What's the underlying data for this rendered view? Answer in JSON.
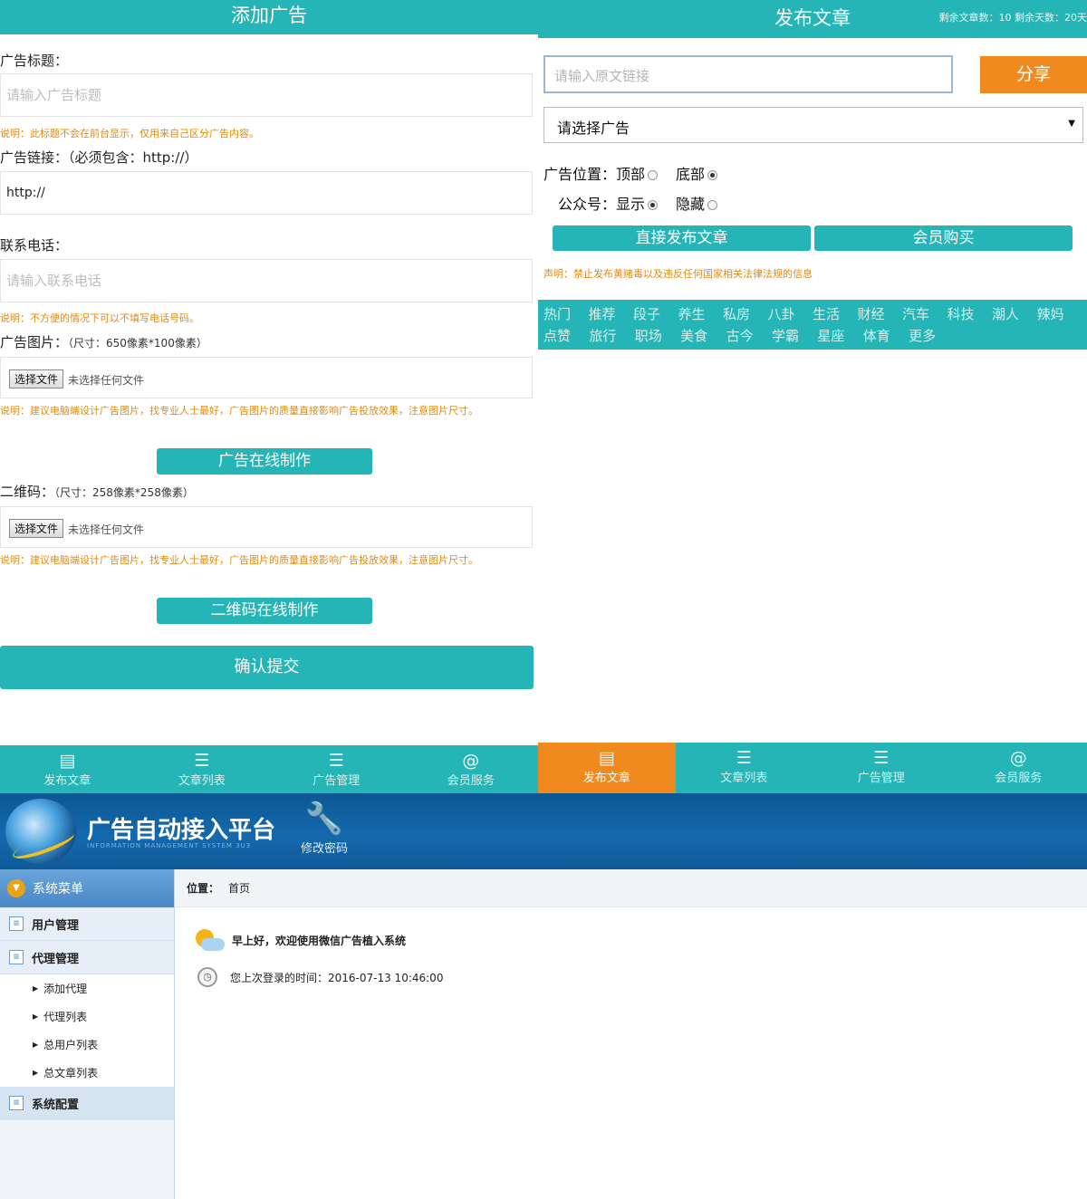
{
  "left": {
    "header": "添加广告",
    "ad_title_label": "广告标题：",
    "ad_title_placeholder": "请输入广告标题",
    "ad_title_note": "说明：此标题不会在前台显示，仅用来自己区分广告内容。",
    "ad_link_label": "广告链接：（必须包含：http://）",
    "ad_link_value": "http://",
    "phone_label": "联系电话：",
    "phone_placeholder": "请输入联系电话",
    "phone_note": "说明：不方便的情况下可以不填写电话号码。",
    "image_label": "广告图片：",
    "image_size": "（尺寸：650像素*100像素）",
    "choose_file": "选择文件",
    "no_file": "未选择任何文件",
    "image_note": "说明：建议电脑端设计广告图片，找专业人士最好，广告图片的质量直接影响广告投放效果，注意图片尺寸。",
    "ad_online_btn": "广告在线制作",
    "qr_label": "二维码：",
    "qr_size": "（尺寸：258像素*258像素）",
    "qr_note": "说明：建议电脑端设计广告图片，找专业人士最好，广告图片的质量直接影响广告投放效果，注意图片尺寸。",
    "qr_online_btn": "二维码在线制作",
    "submit_btn": "确认提交",
    "tabs": [
      "发布文章",
      "文章列表",
      "广告管理",
      "会员服务"
    ]
  },
  "right": {
    "header": "发布文章",
    "header_stats": "剩余文章数：10 剩余天数：20天",
    "url_placeholder": "请输入原文链接",
    "share_btn": "分享",
    "select_value": "请选择广告",
    "position_label": "广告位置：",
    "pos_top": "顶部",
    "pos_bottom": "底部",
    "wechat_label": "公众号：",
    "show": "显示",
    "hide": "隐藏",
    "publish_btn": "直接发布文章",
    "buy_btn": "会员购买",
    "notice": "声明：禁止发布黄赌毒以及违反任何国家相关法律法规的信息",
    "categories_row1": [
      "热门",
      "推荐",
      "段子",
      "养生",
      "私房",
      "八卦",
      "生活",
      "财经",
      "汽车",
      "科技",
      "潮人",
      "辣妈"
    ],
    "categories_row2": [
      "点赞",
      "旅行",
      "职场",
      "美食",
      "古今",
      "学霸",
      "星座",
      "体育",
      "更多"
    ],
    "tabs": [
      "发布文章",
      "文章列表",
      "广告管理",
      "会员服务"
    ]
  },
  "admin": {
    "platform_title": "广告自动接入平台",
    "platform_sub": "INFORMATION MANAGEMENT SYSTEM 3U3",
    "change_pwd": "修改密码",
    "menu_header": "系统菜单",
    "menu": [
      {
        "label": "用户管理"
      },
      {
        "label": "代理管理"
      },
      {
        "label": "系统配置"
      }
    ],
    "submenu": [
      "添加代理",
      "代理列表",
      "总用户列表",
      "总文章列表"
    ],
    "crumb_label": "位置：",
    "crumb_value": "首页",
    "greeting": "早上好，欢迎使用微信广告植入系统",
    "last_login": "您上次登录的时间：2016-07-13 10:46:00"
  },
  "colors": {
    "teal": "#25b5b7",
    "orange": "#f08a1f",
    "blue": "#1469ad",
    "note": "#e08a10"
  }
}
